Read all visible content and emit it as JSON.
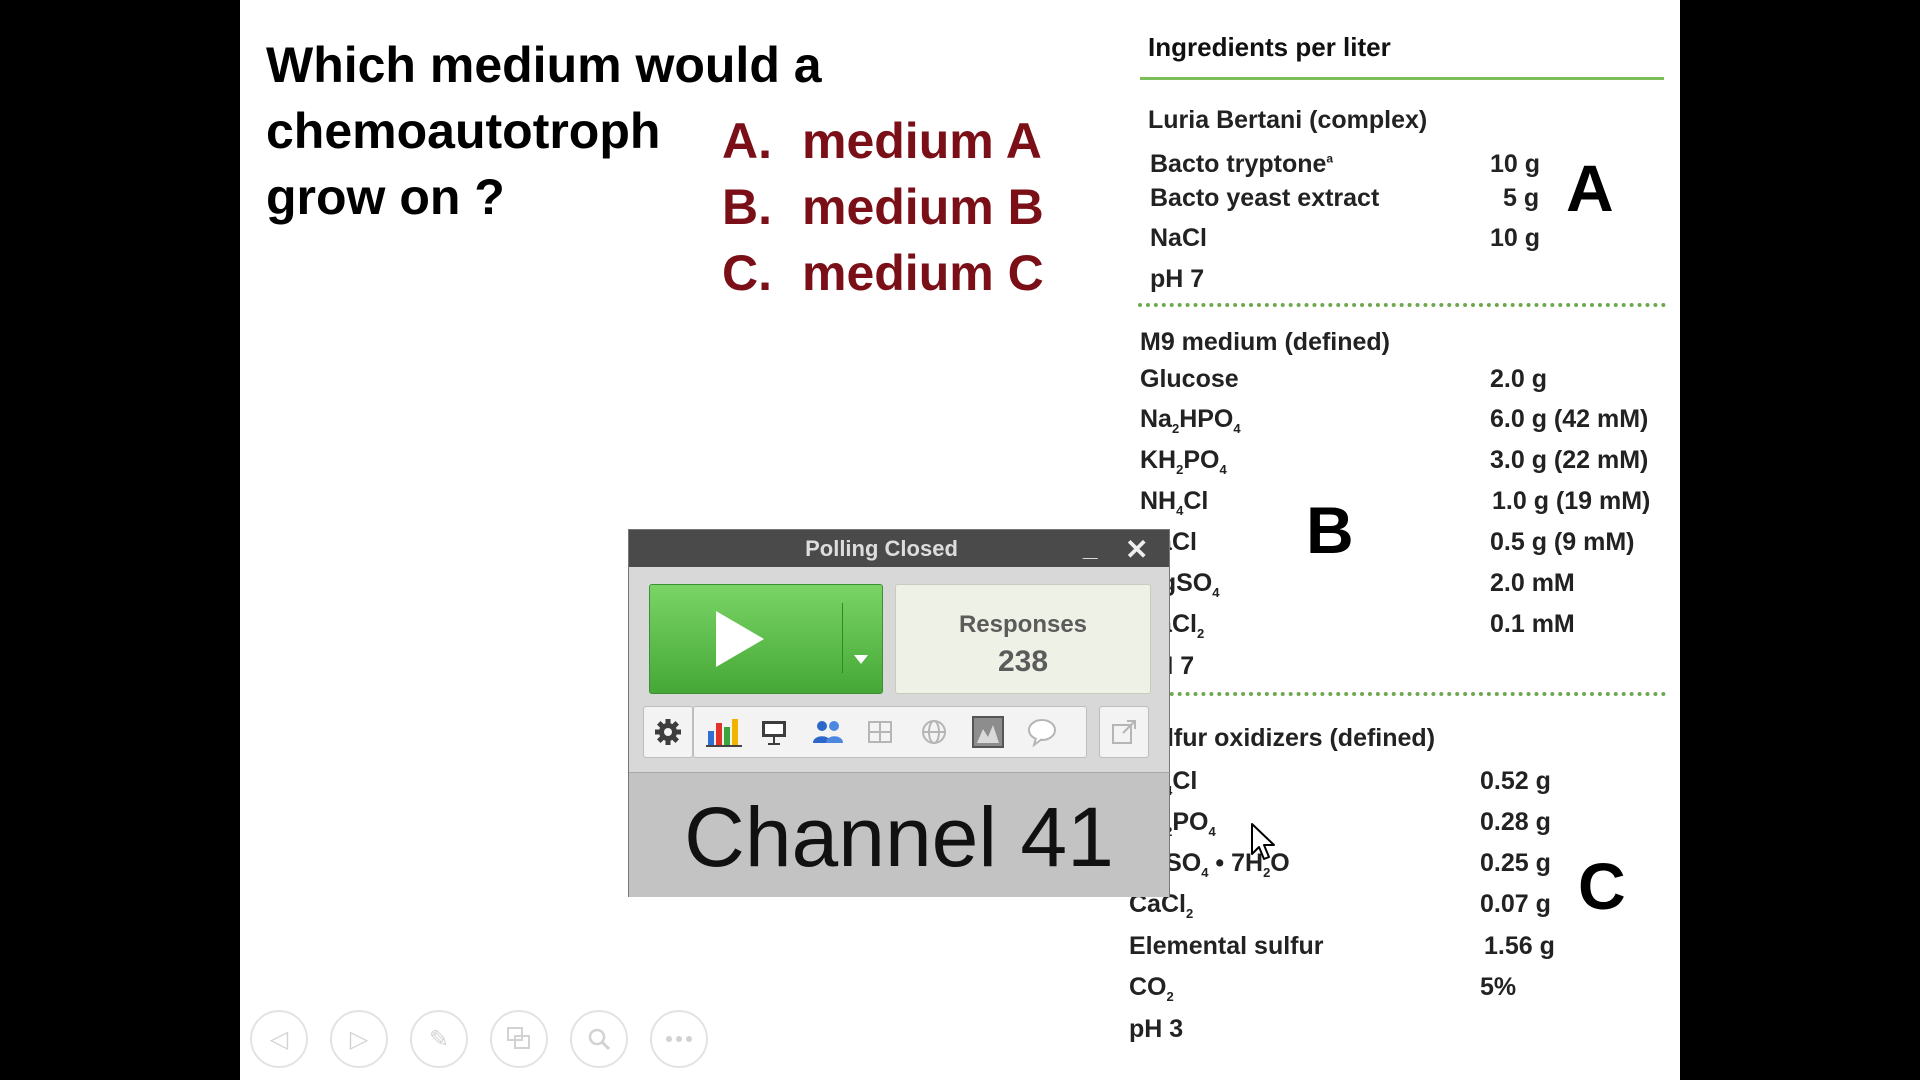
{
  "question": {
    "lines": [
      "Which medium would a",
      "chemoautotroph",
      "grow on ?"
    ],
    "options": [
      {
        "letter": "A.",
        "text": "medium A"
      },
      {
        "letter": "B.",
        "text": "medium B"
      },
      {
        "letter": "C.",
        "text": "medium C"
      }
    ]
  },
  "ingredients": {
    "title": "Ingredients per liter",
    "sections": [
      {
        "name": "Luria Bertani (complex)",
        "letter": "A",
        "rows": [
          {
            "item": "Bacto tryptone",
            "value": "10 g"
          },
          {
            "item": "Bacto yeast extract",
            "value": "5 g"
          },
          {
            "item": "NaCl",
            "value": "10 g"
          },
          {
            "item": "pH 7",
            "value": ""
          }
        ]
      },
      {
        "name": "M9 medium (defined)",
        "letter": "B",
        "rows": [
          {
            "item": "Glucose",
            "value": "2.0 g"
          },
          {
            "item": "Na2HPO4",
            "value": "6.0 g (42 mM)"
          },
          {
            "item": "KH2PO4",
            "value": "3.0 g (22 mM)"
          },
          {
            "item": "NH4Cl",
            "value": "1.0 g (19 mM)"
          },
          {
            "item": "NaCl",
            "value": "0.5 g (9 mM)"
          },
          {
            "item": "MgSO4",
            "value": "2.0 mM"
          },
          {
            "item": "CaCl2",
            "value": "0.1 mM"
          },
          {
            "item": "pH 7",
            "value": ""
          }
        ]
      },
      {
        "name": "Sulfur oxidizers (defined)",
        "letter": "C",
        "rows": [
          {
            "item": "NH4Cl",
            "value": "0.52 g"
          },
          {
            "item": "KH2PO4",
            "value": "0.28 g"
          },
          {
            "item": "MgSO4 • 7H2O",
            "value": "0.25 g"
          },
          {
            "item": "CaCl2",
            "value": "0.07 g"
          },
          {
            "item": "Elemental sulfur",
            "value": "1.56 g"
          },
          {
            "item": "CO2",
            "value": "5%"
          },
          {
            "item": "pH 3",
            "value": ""
          }
        ]
      }
    ]
  },
  "poll": {
    "title": "Polling Closed",
    "minimize": "_",
    "close": "✕",
    "responses_label": "Responses",
    "responses_count": "238",
    "channel": "Channel 41",
    "toolbar_icons": [
      "gear-icon",
      "bar-chart-icon",
      "presentation-icon",
      "participants-icon",
      "grid-icon",
      "globe-icon",
      "chart-image-icon",
      "comment-icon",
      "external-link-icon"
    ]
  },
  "nav_icons": [
    "previous-icon",
    "next-icon",
    "pen-icon",
    "slides-icon",
    "zoom-icon",
    "more-icon"
  ],
  "colors": {
    "option_color": "#7a0f17",
    "rule_green": "#7cbf5a",
    "play_green": "#45a836"
  }
}
